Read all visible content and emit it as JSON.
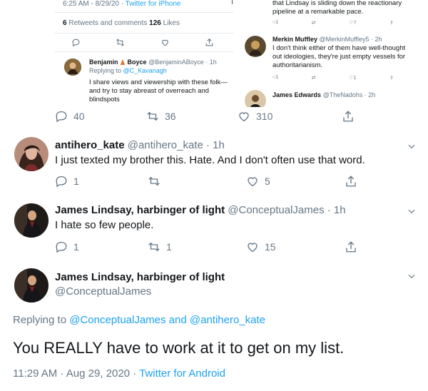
{
  "embed": {
    "meta_time": "6:25 AM - 8/29/20",
    "meta_sep": " · ",
    "meta_source": "Twitter for iPhone",
    "retweets_count": "6",
    "retweets_label": " Retweets and comments ",
    "likes_count": "126",
    "likes_label": " Likes",
    "reply": {
      "name_a": "Benjamin",
      "name_b": "Boyce",
      "handle_time": "@BenjaminABoyce · 1h",
      "replying_label": "Replying to ",
      "replying_handle": "@C_Kavanagh",
      "text": "I share views and viewership with these folk—and try to stay abreast of overreach and blindspots"
    },
    "right": {
      "top_text": "that Lindsay is sliding down the reactionary pipeline at a remarkable pace.",
      "top_counts": {
        "reply": "1",
        "retweet": "",
        "like": "7"
      },
      "merkin_name": "Merkin Muffley",
      "merkin_handle": "@MerkinMuffley5 · 2h",
      "merkin_text": "I don't think either of them have well-thought out ideologies, they're just empty vessels for authoritarianism.",
      "merkin_counts": {
        "reply": "1",
        "retweet": "",
        "like": "1"
      },
      "james_name": "James Edwards",
      "james_handle": "@TheNadohs · 2h"
    }
  },
  "embed_actions": {
    "reply": "40",
    "retweet": "36",
    "like": "310"
  },
  "tweets": [
    {
      "name": "antihero_kate",
      "handle_time": " @antihero_kate · 1h",
      "text": "I just texted my brother this. Hate. And I don't often use that word.",
      "reply": "1",
      "retweet": "",
      "like": "5"
    },
    {
      "name": "James Lindsay, harbinger of light",
      "handle_time": " @ConceptualJames · 1h",
      "text": "I hate so few people.",
      "reply": "1",
      "retweet": "1",
      "like": "15"
    }
  ],
  "main": {
    "name": "James Lindsay, harbinger of light",
    "handle": "@ConceptualJames",
    "replying_label": "Replying to ",
    "replying_a": "@ConceptualJames",
    "replying_and": " and ",
    "replying_b": "@antihero_kate",
    "text": "You REALLY have to work at it to get on my list.",
    "time": "11:29 AM · Aug 29, 2020",
    "sep": " · ",
    "source": "Twitter for Android"
  },
  "colors": {
    "accent": "#1da1f2",
    "muted": "#657786",
    "text": "#14171a",
    "divider": "#e6ecf0"
  }
}
